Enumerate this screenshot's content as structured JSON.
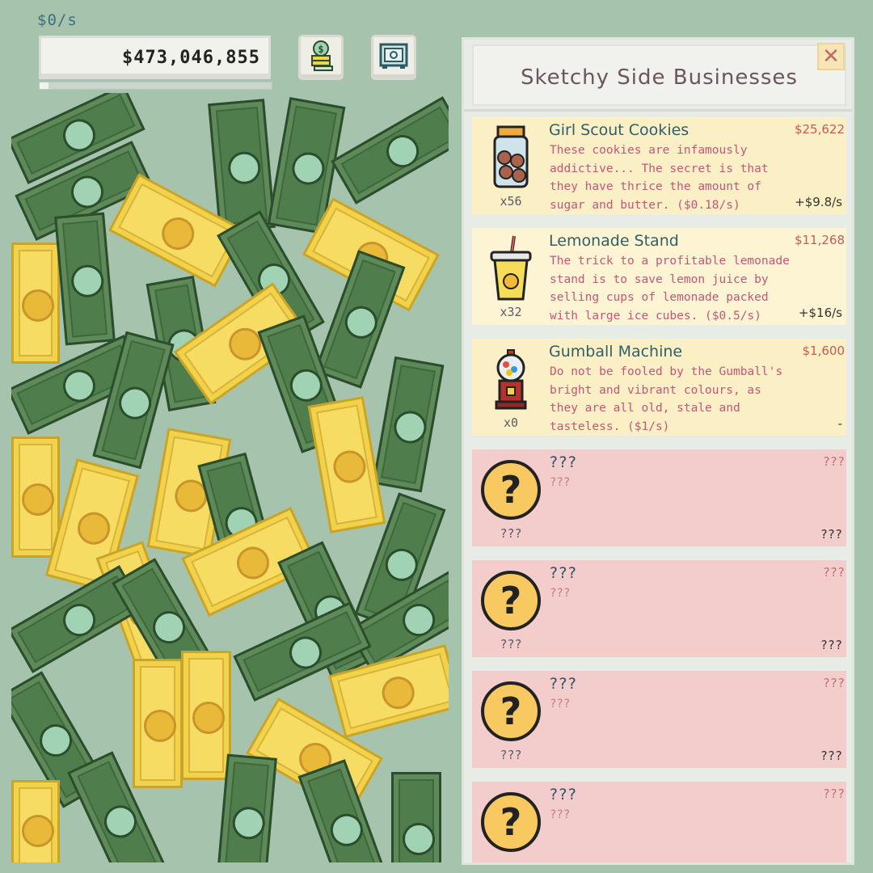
{
  "hud": {
    "rate": "$0/s",
    "money": "$473,046,855",
    "progress": 0.04
  },
  "icons": {
    "coins_button": "coin-stack-icon",
    "safe_button": "safe-icon",
    "close": "close-icon"
  },
  "panel": {
    "title": "Sketchy Side Businesses",
    "close_label": "✕"
  },
  "businesses": [
    {
      "name": "Girl Scout Cookies",
      "price": "$25,622",
      "description": "These cookies are infamously addictive... The secret is that they have thrice the amount of sugar and butter. ($0.18/s)",
      "count": "x56",
      "gain": "+$9.8/s",
      "icon": "cookie-jar-icon"
    },
    {
      "name": "Lemonade Stand",
      "price": "$11,268",
      "description": "The trick to a profitable lemonade stand is to save lemon juice by selling cups of lemonade packed with large ice cubes. ($0.5/s)",
      "count": "x32",
      "gain": "+$16/s",
      "icon": "lemonade-cup-icon"
    },
    {
      "name": "Gumball Machine",
      "price": "$1,600",
      "description": "Do not be fooled by the Gumball's bright and vibrant colours, as they are all old, stale and tasteless. ($1/s)",
      "count": "x0",
      "gain": "-",
      "icon": "gumball-machine-icon"
    },
    {
      "name": "???",
      "price": "???",
      "description": "???",
      "count": "???",
      "gain": "???",
      "icon": "question-mark-icon"
    },
    {
      "name": "???",
      "price": "???",
      "description": "???",
      "count": "???",
      "gain": "???",
      "icon": "question-mark-icon"
    },
    {
      "name": "???",
      "price": "???",
      "description": "???",
      "count": "???",
      "gain": "???",
      "icon": "question-mark-icon"
    },
    {
      "name": "???",
      "price": "???",
      "description": "???",
      "count": "???",
      "gain": "???",
      "icon": "question-mark-icon"
    }
  ],
  "colors": {
    "background": "#a5c3ad",
    "bill_green": "#5d8a58",
    "bill_gold": "#f2d24a",
    "card_known": "#fbefc5",
    "card_locked": "#f2cdcc",
    "title_text": "#6b5660",
    "name_text": "#2f5f6a",
    "price_text": "#c75a5a",
    "desc_text": "#c2577a"
  }
}
